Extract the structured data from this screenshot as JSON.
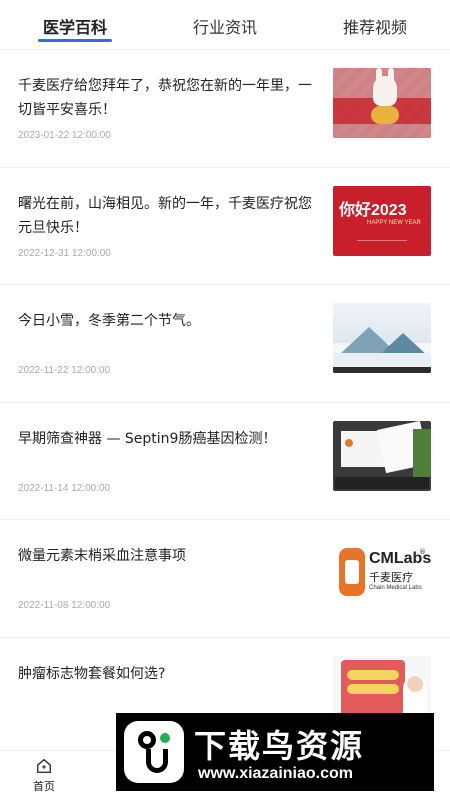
{
  "tabs": [
    {
      "label": "医学百科",
      "active": true
    },
    {
      "label": "行业资讯",
      "active": false
    },
    {
      "label": "推荐视频",
      "active": false
    }
  ],
  "articles": [
    {
      "title": "千麦医疗给您拜年了，恭祝您在新的一年里，一切皆平安喜乐！",
      "date": "2023-01-22 12:00:00"
    },
    {
      "title": "曙光在前，山海相见。新的一年，千麦医疗祝您元旦快乐！",
      "date": "2022-12-31 12:00:00"
    },
    {
      "title": "今日小雪，冬季第二个节气。",
      "date": "2022-11-22 12:00:00"
    },
    {
      "title": "早期筛查神器 — Septin9肠癌基因检测！",
      "date": "2022-11-14 12:00:00"
    },
    {
      "title": "微量元素末梢采血注意事项",
      "date": "2022-11-08 12:00:00"
    },
    {
      "title": "肿瘤标志物套餐如何选?",
      "date": ""
    }
  ],
  "thumbs": {
    "t2_big": "你好2023",
    "t2_small": "HAPPY NEW YEAR",
    "t5_brand": "CMLabs",
    "t5_reg": "®",
    "t5_cn": "千麦医疗",
    "t5_en": "Chain Medical Labs"
  },
  "bottom_nav": {
    "home_label": "首页",
    "home_icon": "home-icon"
  },
  "watermark": {
    "title": "下载鸟资源",
    "url": "www.xiazainiao.com"
  },
  "colors": {
    "accent": "#2f6fe4",
    "watermark_green": "#1cb253"
  }
}
